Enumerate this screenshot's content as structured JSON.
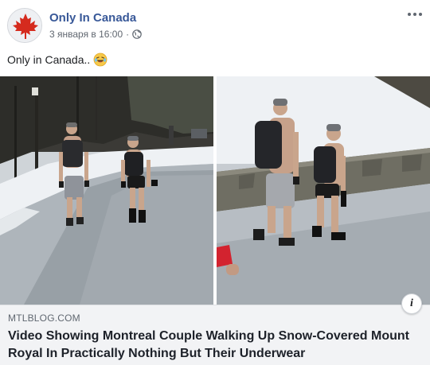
{
  "post": {
    "page_name": "Only In Canada",
    "timestamp": "3 января в 16:00",
    "separator": "·",
    "privacy_icon": "globe-icon",
    "more_icon": "more-options-icon",
    "text": "Only in Canada..",
    "emoji": "laughing-crying-emoji"
  },
  "media": {
    "description_icon": "video-thumbnail"
  },
  "link_preview": {
    "domain": "MTLBLOG.COM",
    "headline": "Video Showing Montreal Couple Walking Up Snow-Covered Mount Royal In Practically Nothing But Their Underwear",
    "info_label": "i"
  },
  "colors": {
    "page_name": "#385898",
    "meta_text": "#606770",
    "preview_bg": "#f2f3f5",
    "maple_leaf": "#d52b1e"
  }
}
